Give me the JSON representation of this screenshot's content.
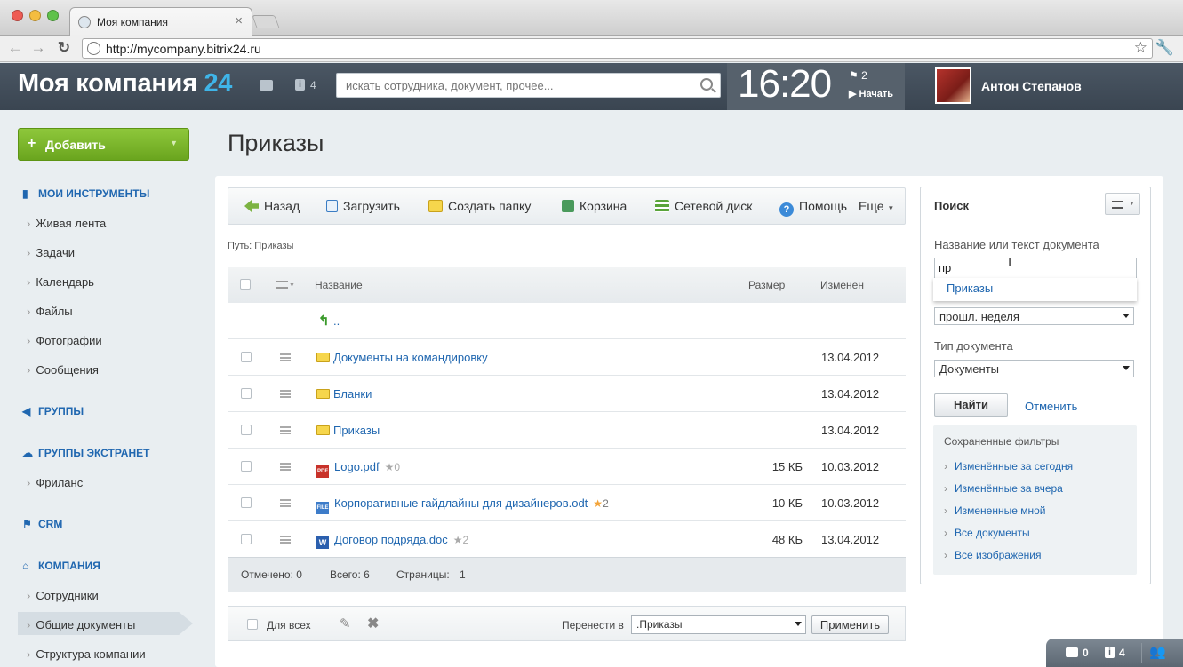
{
  "browser": {
    "tab_title": "Моя компания",
    "url": "http://mycompany.bitrix24.ru"
  },
  "header": {
    "logo_text": "Моя компания",
    "logo_num": "24",
    "notifications_count": "4",
    "search_placeholder": "искать сотрудника, документ, прочее...",
    "clock": "16:20",
    "flag_count": "2",
    "start_label": "Начать",
    "user_name": "Антон Степанов"
  },
  "sidebar": {
    "add_button": "Добавить",
    "sections": [
      {
        "title": "МОИ ИНСТРУМЕНТЫ",
        "items": [
          "Живая лента",
          "Задачи",
          "Календарь",
          "Файлы",
          "Фотографии",
          "Сообщения"
        ]
      },
      {
        "title": "ГРУППЫ",
        "items": []
      },
      {
        "title": "ГРУППЫ ЭКСТРАНЕТ",
        "items": [
          "Фриланс"
        ]
      },
      {
        "title": "CRM",
        "items": []
      },
      {
        "title": "КОМПАНИЯ",
        "items": [
          "Сотрудники",
          "Общие документы",
          "Структура компании"
        ]
      }
    ]
  },
  "page": {
    "title": "Приказы",
    "path_label": "Путь:",
    "path_value": "Приказы"
  },
  "toolbar": {
    "back": "Назад",
    "upload": "Загрузить",
    "create_folder": "Создать папку",
    "trash": "Корзина",
    "network_drive": "Сетевой диск",
    "help": "Помощь",
    "more": "Еще"
  },
  "table": {
    "col_name": "Название",
    "col_size": "Размер",
    "col_modified": "Изменен",
    "up_link": "..",
    "rows": [
      {
        "name": "Документы на командировку",
        "type": "folder",
        "size": "",
        "date": "13.04.2012",
        "rating": ""
      },
      {
        "name": "Бланки",
        "type": "folder",
        "size": "",
        "date": "13.04.2012",
        "rating": ""
      },
      {
        "name": "Приказы",
        "type": "folder",
        "size": "",
        "date": "13.04.2012",
        "rating": ""
      },
      {
        "name": "Logo.pdf",
        "type": "pdf",
        "size": "15 КБ",
        "date": "10.03.2012",
        "rating": "0"
      },
      {
        "name": "Корпоративные гайдлайны для дизайнеров.odt",
        "type": "odt",
        "size": "10 КБ",
        "date": "10.03.2012",
        "rating": "2"
      },
      {
        "name": "Договор подряда.doc",
        "type": "doc",
        "size": "48 КБ",
        "date": "13.04.2012",
        "rating": "2"
      }
    ],
    "footer": {
      "checked": "Отмечено: 0",
      "total": "Всего: 6",
      "pages_label": "Страницы:",
      "pages_value": "1"
    }
  },
  "actions": {
    "for_all": "Для всех",
    "move_to": "Перенести в",
    "move_value": ".Приказы",
    "apply": "Применить"
  },
  "search_panel": {
    "title": "Поиск",
    "name_label": "Название или текст документа",
    "name_value": "пр",
    "suggestion": "Приказы",
    "period_value": "прошл. неделя",
    "doctype_label": "Тип документа",
    "doctype_value": "Документы",
    "find_button": "Найти",
    "cancel_link": "Отменить",
    "saved_title": "Сохраненные фильтры",
    "saved_filters": [
      "Изменённые за сегодня",
      "Изменённые за вчера",
      "Измененные мной",
      "Все документы",
      "Все изображения"
    ]
  },
  "bottom_bar": {
    "messages": "0",
    "notifications": "4"
  },
  "colors": {
    "accent": "#2067b0",
    "header_bg": "#414d59",
    "add_button": "#7bb62a",
    "logo_num": "#3fb5e8",
    "star_on": "#f3a43a"
  }
}
